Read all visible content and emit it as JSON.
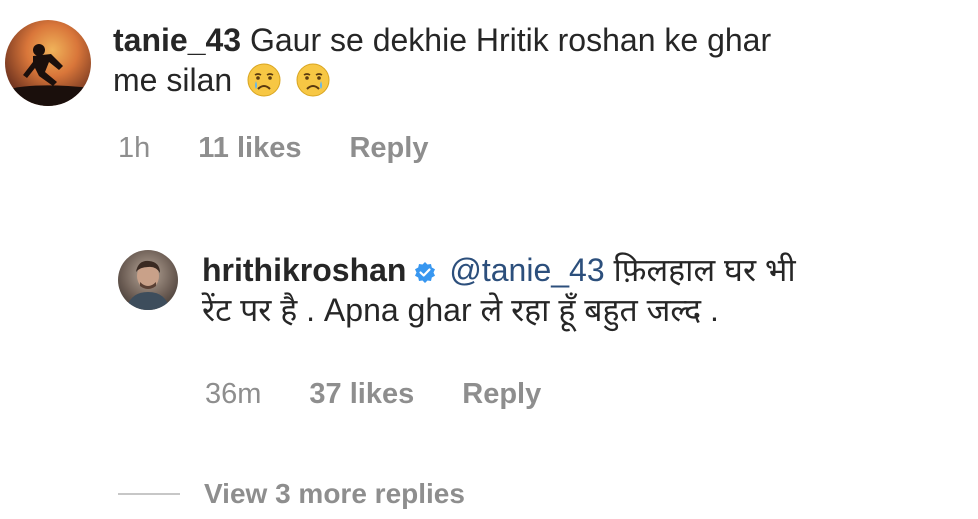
{
  "comment": {
    "username": "tanie_43",
    "text_line1": "Gaur se dekhie Hritik roshan ke ghar",
    "text_line2": "me silan",
    "emojis": [
      "crying-face-icon",
      "crying-face-icon"
    ],
    "time": "1h",
    "likes": "11 likes",
    "reply": "Reply"
  },
  "reply": {
    "username": "hrithikroshan",
    "verified": true,
    "mention": "@tanie_43",
    "text_line1": "फ़िलहाल घर भी",
    "text_line2": "रेंट पर है . Apna ghar ले रहा हूँ बहुत जल्द .",
    "time": "36m",
    "likes": "37 likes",
    "reply": "Reply"
  },
  "view_more": "View 3 more replies",
  "colors": {
    "text": "#262626",
    "meta": "#8e8e8e",
    "mention": "#2c4f7c",
    "verified": "#3897f0"
  }
}
